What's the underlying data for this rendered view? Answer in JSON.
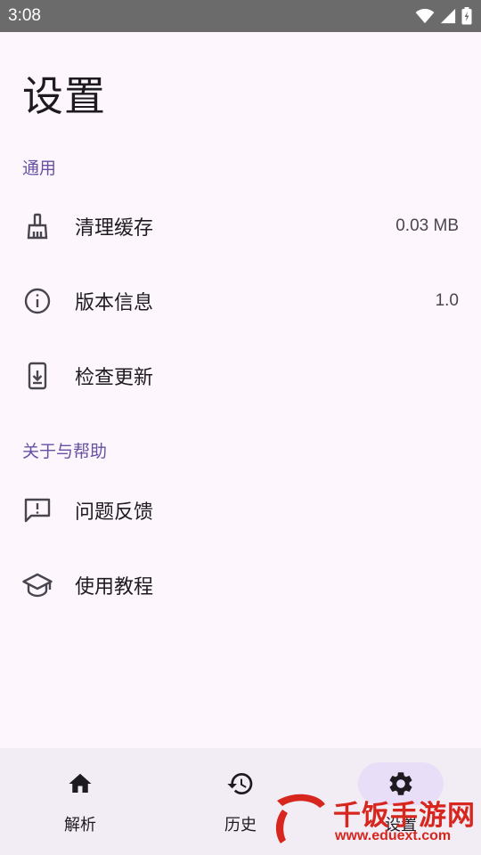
{
  "status_bar": {
    "time": "3:08"
  },
  "page": {
    "title": "设置"
  },
  "sections": [
    {
      "header": "通用",
      "items": [
        {
          "icon": "broom-icon",
          "label": "清理缓存",
          "value": "0.03 MB"
        },
        {
          "icon": "info-icon",
          "label": "版本信息",
          "value": "1.0"
        },
        {
          "icon": "phone-download-icon",
          "label": "检查更新",
          "value": ""
        }
      ]
    },
    {
      "header": "关于与帮助",
      "items": [
        {
          "icon": "feedback-icon",
          "label": "问题反馈",
          "value": ""
        },
        {
          "icon": "school-icon",
          "label": "使用教程",
          "value": ""
        }
      ]
    }
  ],
  "bottom_nav": {
    "items": [
      {
        "icon": "home-icon",
        "label": "解析",
        "active": false
      },
      {
        "icon": "history-icon",
        "label": "历史",
        "active": false
      },
      {
        "icon": "gear-icon",
        "label": "设置",
        "active": true
      }
    ]
  },
  "watermark": {
    "title": "千饭手游网",
    "url": "www.eduext.com",
    "logo_char": "饭"
  },
  "colors": {
    "accent": "#6750a4",
    "background": "#fdf7fd",
    "nav_background": "#f2ecf4",
    "active_pill": "#e8def8",
    "watermark": "#d7261e"
  }
}
